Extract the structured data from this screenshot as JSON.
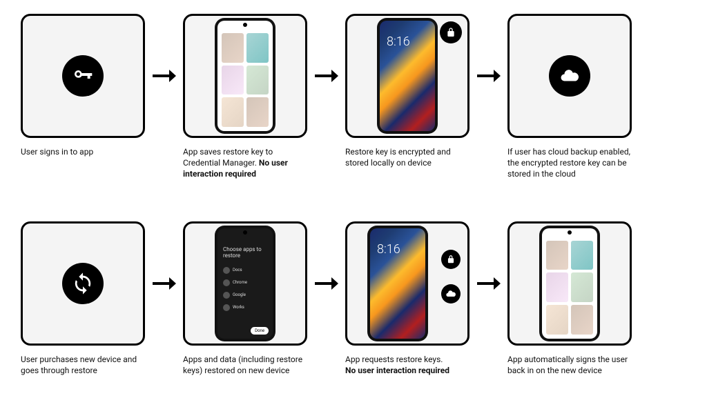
{
  "row1": {
    "step1": {
      "caption": "User signs in to app"
    },
    "step2": {
      "caption_pre": "App saves restore key to Credential Manager. ",
      "caption_bold": "No user interaction required"
    },
    "step3": {
      "caption": "Restore key is encrypted and stored locally on device",
      "clock": "8:16"
    },
    "step4": {
      "caption": "If user has cloud backup enabled, the encrypted restore key can be stored in the cloud"
    }
  },
  "row2": {
    "step1": {
      "caption": "User purchases new device and goes through restore"
    },
    "step2": {
      "caption": "Apps and data (including restore keys) restored on new device",
      "dark_title": "Choose apps to restore",
      "dark_items": [
        "Docs",
        "Chrome",
        "Google",
        "Works"
      ],
      "dark_done": "Done"
    },
    "step3": {
      "caption_pre": "App requests restore keys.",
      "caption_bold": "No user interaction required",
      "clock": "8:16"
    },
    "step4": {
      "caption": "App automatically signs the user back in on the new device"
    }
  }
}
